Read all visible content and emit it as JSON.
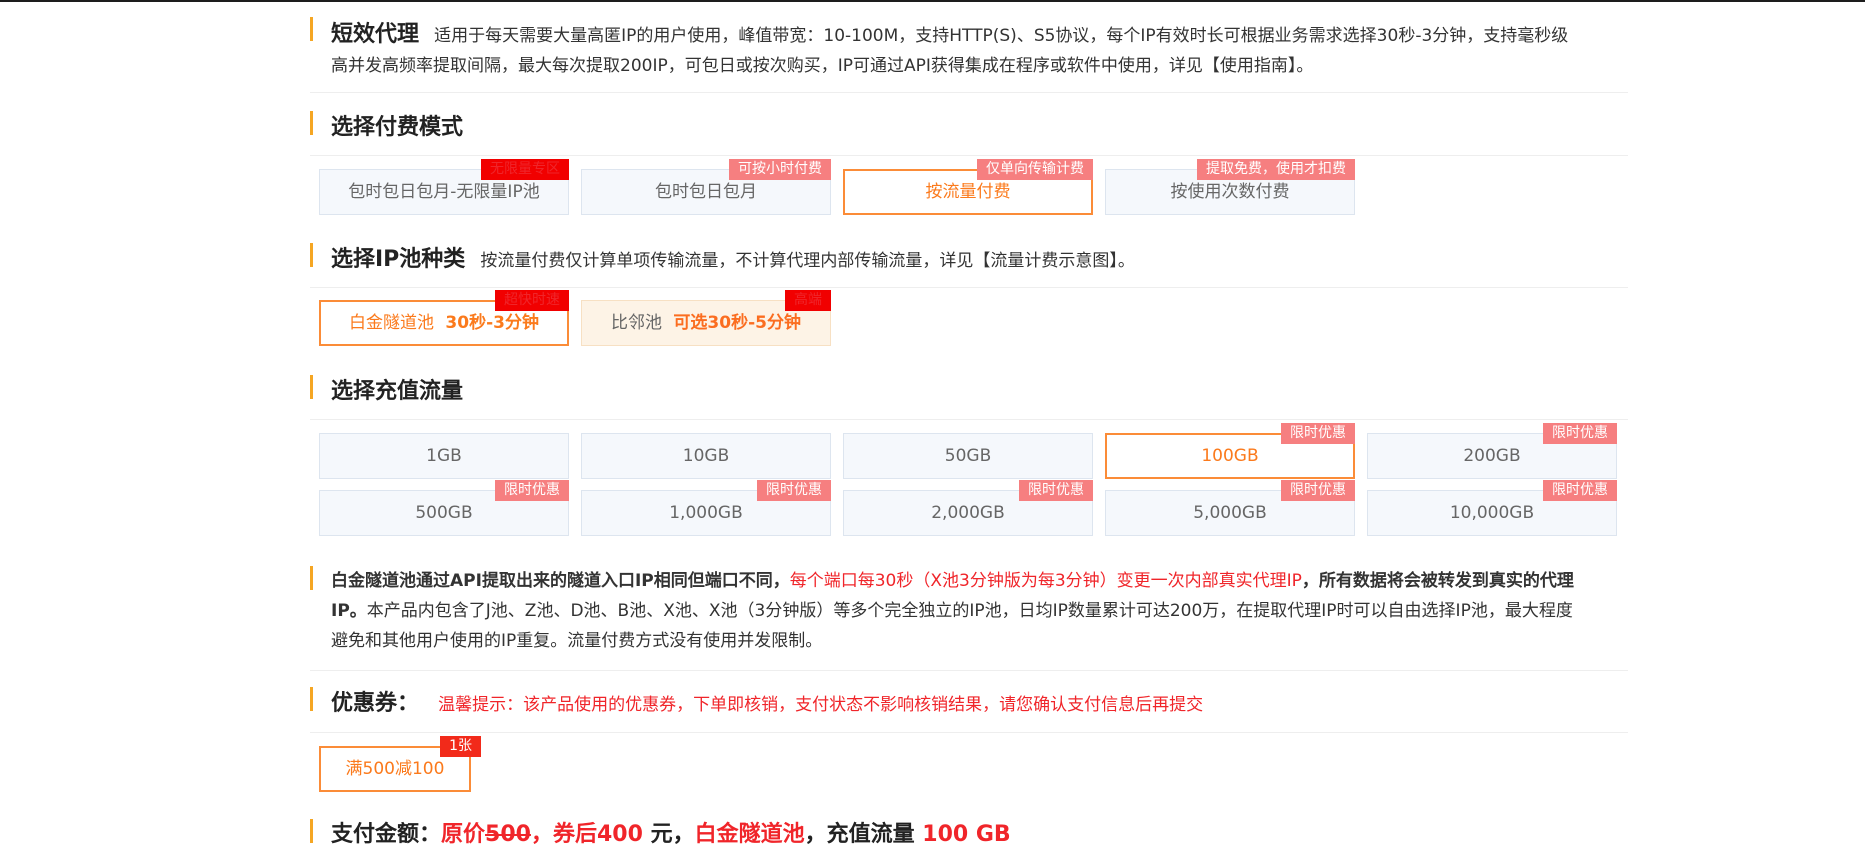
{
  "intro": {
    "title": "短效代理",
    "desc_line1": "适用于每天需要大量高匿IP的用户使用，峰值带宽：10-100M，支持HTTP(S)、S5协议，每个IP有效时长可根据业务需求选择30秒-3分钟，支持毫秒级",
    "desc_line2": "高并发高频率提取间隔，最大每次提取200IP，可包日或按次购买，IP可通过API获得集成在程序或软件中使用，详见【使用指南】。"
  },
  "pay_mode": {
    "title": "选择付费模式",
    "options": [
      {
        "label": "包时包日包月-无限量IP池",
        "tag": "无限量专区"
      },
      {
        "label": "包时包日包月",
        "tag": "可按小时付费"
      },
      {
        "label": "按流量付费",
        "tag": "仅单向传输计费"
      },
      {
        "label": "按使用次数付费",
        "tag": "提取免费，使用才扣费"
      }
    ]
  },
  "ip_pool": {
    "title": "选择IP池种类",
    "desc": "按流量付费仅计算单项传输流量，不计算代理内部传输流量，详见【流量计费示意图】。",
    "options": [
      {
        "name": "白金隧道池",
        "range": "30秒-3分钟",
        "tag": "超快时速"
      },
      {
        "name": "比邻池",
        "range": "可选30秒-5分钟",
        "tag": "高端"
      }
    ]
  },
  "traffic": {
    "title": "选择充值流量",
    "options": [
      {
        "label": "1GB",
        "tag": ""
      },
      {
        "label": "10GB",
        "tag": ""
      },
      {
        "label": "50GB",
        "tag": ""
      },
      {
        "label": "100GB",
        "tag": "限时优惠"
      },
      {
        "label": "200GB",
        "tag": "限时优惠"
      },
      {
        "label": "500GB",
        "tag": "限时优惠"
      },
      {
        "label": "1,000GB",
        "tag": "限时优惠"
      },
      {
        "label": "2,000GB",
        "tag": "限时优惠"
      },
      {
        "label": "5,000GB",
        "tag": "限时优惠"
      },
      {
        "label": "10,000GB",
        "tag": "限时优惠"
      }
    ]
  },
  "note": {
    "bold1": "白金隧道池通过API提取出来的隧道入口IP相同但端口不同，",
    "red": "每个端口每30秒（X池3分钟版为每3分钟）变更一次内部真实代理IP",
    "bold2a": "，所有数据将会被转发到真实的代理",
    "bold2b": "IP。",
    "rest_a": "本产品内包含了J池、Z池、D池、B池、X池、X池（3分钟版）等多个完全独立的IP池，日均IP数量累计可达200万，在提取代理IP时可以自由选择IP池，最大程度",
    "rest_b": "避免和其他用户使用的IP重复。流量付费方式没有使用并发限制。"
  },
  "coupon": {
    "title": "优惠券：",
    "tip": "温馨提示：该产品使用的优惠券，下单即核销，支付状态不影响核销结果，请您确认支付信息后再提交",
    "item_label": "满500减100",
    "item_tag": "1张"
  },
  "payment": {
    "label": "支付金额：",
    "orig_prefix": "原价",
    "orig_amount": "500",
    "after_text": "，券后",
    "after_amount": "400",
    "yuan": " 元，",
    "pool": "白金隧道池",
    "traffic_text": "，充值流量 ",
    "traffic_amount": "100 GB"
  },
  "colors": {
    "accent": "#f5a623",
    "selected": "#fb8c38",
    "red": "#f0252a",
    "tag_pink": "#f67f80"
  }
}
